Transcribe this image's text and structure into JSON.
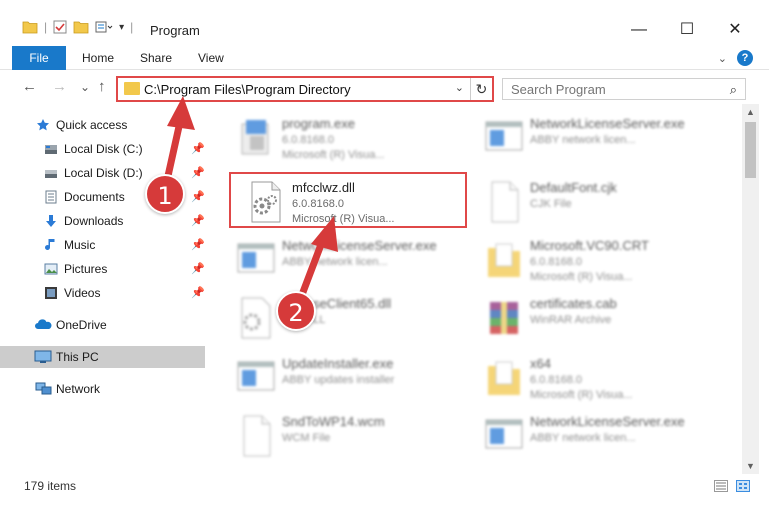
{
  "window": {
    "title": "Program",
    "minimize": "—",
    "maximize": "☐",
    "close": "✕"
  },
  "ribbon": {
    "tabs": [
      "File",
      "Home",
      "Share",
      "View"
    ],
    "help": "?"
  },
  "nav": {
    "back": "←",
    "forward": "→",
    "recent": "⌄",
    "up": "↑",
    "address": "C:\\Program Files\\Program Directory",
    "dropdown": "⌄",
    "refresh": "↻",
    "search_placeholder": "Search Program"
  },
  "sidebar": {
    "items": [
      {
        "label": "Quick access",
        "icon": "star-icon"
      },
      {
        "label": "Local Disk (C:)",
        "icon": "drive-icon",
        "pinned": true
      },
      {
        "label": "Local Disk (D:)",
        "icon": "drive-icon",
        "pinned": true
      },
      {
        "label": "Documents",
        "icon": "documents-icon",
        "pinned": true
      },
      {
        "label": "Downloads",
        "icon": "downloads-icon",
        "pinned": true
      },
      {
        "label": "Music",
        "icon": "music-icon",
        "pinned": true
      },
      {
        "label": "Pictures",
        "icon": "pictures-icon",
        "pinned": true
      },
      {
        "label": "Videos",
        "icon": "videos-icon",
        "pinned": true
      },
      {
        "label": "OneDrive",
        "icon": "onedrive-icon"
      },
      {
        "label": "This PC",
        "icon": "pc-icon",
        "selected": true
      },
      {
        "label": "Network",
        "icon": "network-icon"
      }
    ]
  },
  "files": [
    {
      "name": "program.exe",
      "line2": "6.0.8168.0",
      "line3": "Microsoft (R) Visua...",
      "icon": "exe-icon"
    },
    {
      "name": "NetworkLicenseServer.exe",
      "line2": "ABBY network licen...",
      "line3": "",
      "icon": "window-app-icon"
    },
    {
      "name": "mfcclwz.dll",
      "line2": "6.0.8168.0",
      "line3": "Microsoft (R) Visua...",
      "icon": "dll-gear-icon"
    },
    {
      "name": "DefaultFont.cjk",
      "line2": "CJK File",
      "line3": "",
      "icon": "blank-file-icon"
    },
    {
      "name": "NetworkLicenseServer.exe",
      "line2": "ABBY network licen...",
      "line3": "",
      "icon": "window-app-icon"
    },
    {
      "name": "Microsoft.VC90.CRT",
      "line2": "6.0.8168.0",
      "line3": "Microsoft (R) Visua...",
      "icon": "folder-doc-icon"
    },
    {
      "name": "LicenseClient65.dll",
      "line2": "Lica DLL",
      "line3": "",
      "icon": "dll-gear-icon"
    },
    {
      "name": "certificates.cab",
      "line2": "WinRAR Archive",
      "line3": "",
      "icon": "winrar-icon"
    },
    {
      "name": "UpdateInstaller.exe",
      "line2": "ABBY updates installer",
      "line3": "",
      "icon": "window-app-icon"
    },
    {
      "name": "x64",
      "line2": "6.0.8168.0",
      "line3": "Microsoft (R) Visua...",
      "icon": "folder-doc-icon"
    },
    {
      "name": "SndToWP14.wcm",
      "line2": "WCM File",
      "line3": "",
      "icon": "blank-file-icon"
    },
    {
      "name": "NetworkLicenseServer.exe",
      "line2": "ABBY network licen...",
      "line3": "",
      "icon": "window-app-icon"
    }
  ],
  "status": {
    "items": "179 items"
  },
  "annotations": {
    "step1": "1",
    "step2": "2"
  },
  "colors": {
    "accent": "#1979ca",
    "highlight": "#e04848",
    "badge": "#d63a3a",
    "folder": "#f2c84b"
  }
}
